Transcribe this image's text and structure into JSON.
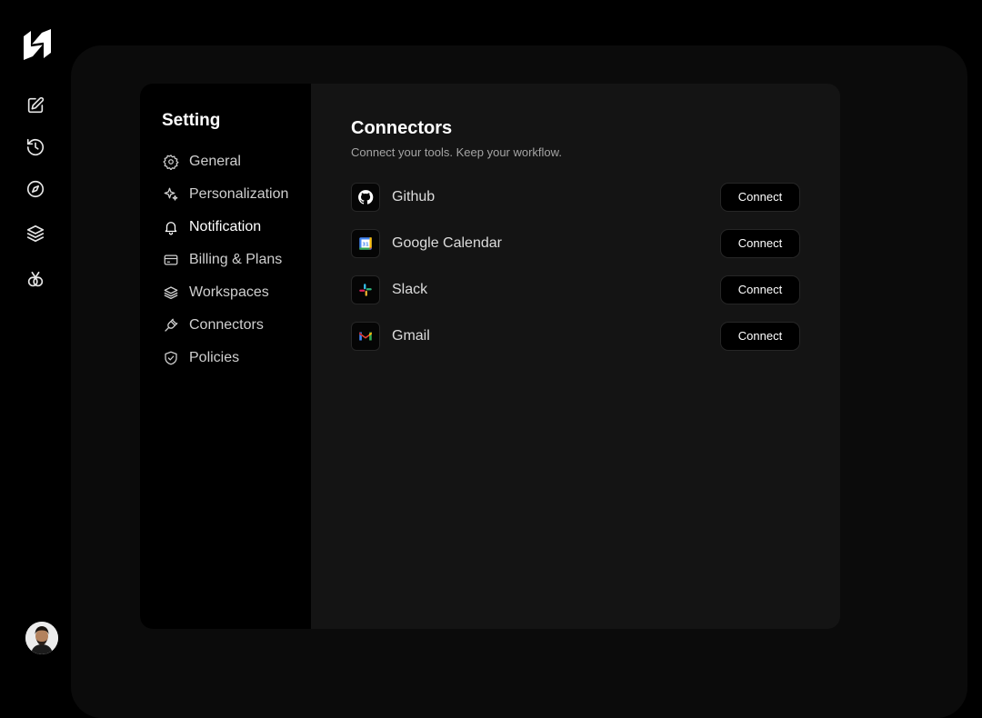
{
  "rail": {
    "logo_icon": "brand-logo",
    "items": [
      {
        "icon": "new-chat-icon"
      },
      {
        "icon": "history-icon"
      },
      {
        "icon": "compass-icon"
      },
      {
        "icon": "layers-icon"
      },
      {
        "icon": "plugin-icon"
      }
    ],
    "avatar_icon": "user-avatar"
  },
  "settings": {
    "title": "Setting",
    "nav": [
      {
        "label": "General",
        "icon": "gear-icon"
      },
      {
        "label": "Personalization",
        "icon": "sparkle-icon"
      },
      {
        "label": "Notification",
        "icon": "bell-icon",
        "active": true
      },
      {
        "label": "Billing & Plans",
        "icon": "card-icon"
      },
      {
        "label": "Workspaces",
        "icon": "layers-icon"
      },
      {
        "label": "Connectors",
        "icon": "plug-icon"
      },
      {
        "label": "Policies",
        "icon": "shield-check-icon"
      }
    ]
  },
  "connectors": {
    "title": "Connectors",
    "subtitle": "Connect your tools. Keep your workflow.",
    "items": [
      {
        "name": "Github",
        "icon": "github-icon",
        "button": "Connect"
      },
      {
        "name": "Google Calendar",
        "icon": "google-calendar-icon",
        "button": "Connect"
      },
      {
        "name": "Slack",
        "icon": "slack-icon",
        "button": "Connect"
      },
      {
        "name": "Gmail",
        "icon": "gmail-icon",
        "button": "Connect"
      }
    ]
  },
  "colors": {
    "background": "#000000",
    "panel": "#141414",
    "stage": "#0b0b0b",
    "text_muted": "#a4a4a4"
  }
}
